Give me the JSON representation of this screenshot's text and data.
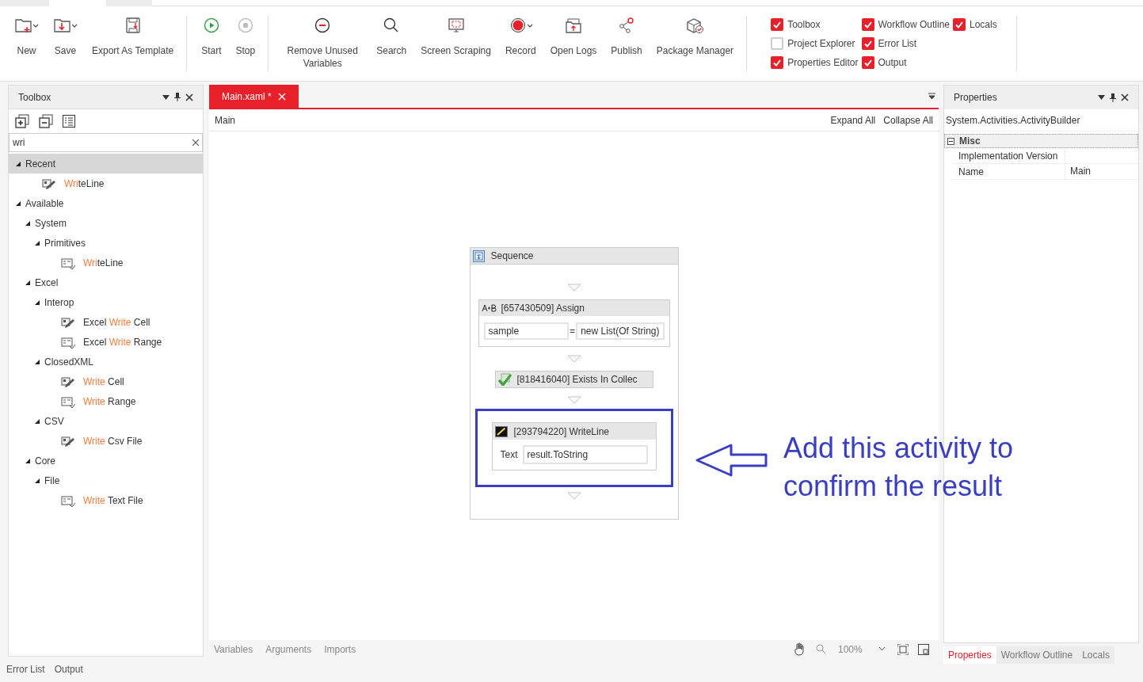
{
  "toolbar": {
    "groups": [
      {
        "buttons": [
          {
            "label": "New",
            "dropdown": true
          },
          {
            "label": "Save",
            "dropdown": true
          },
          {
            "label": "Export As Template",
            "dropdown": false
          }
        ]
      },
      {
        "buttons": [
          {
            "label": "Start",
            "dropdown": false
          },
          {
            "label": "Stop",
            "dropdown": false
          }
        ]
      },
      {
        "buttons": [
          {
            "label": "Remove Unused Variables",
            "dropdown": false
          },
          {
            "label": "Search",
            "dropdown": false
          },
          {
            "label": "Screen Scraping",
            "dropdown": false
          },
          {
            "label": "Record",
            "dropdown": true
          },
          {
            "label": "Open Logs",
            "dropdown": false
          },
          {
            "label": "Publish",
            "dropdown": false
          },
          {
            "label": "Package Manager",
            "dropdown": false
          }
        ]
      }
    ],
    "panel_toggles": [
      {
        "label": "Toolbox",
        "checked": true
      },
      {
        "label": "Workflow Outline",
        "checked": true
      },
      {
        "label": "Locals",
        "checked": true
      },
      {
        "label": "Project Explorer",
        "checked": false
      },
      {
        "label": "Error List",
        "checked": true
      },
      {
        "label": "Properties Editor",
        "checked": true
      },
      {
        "label": "Output",
        "checked": true
      }
    ]
  },
  "toolbox": {
    "title": "Toolbox",
    "search": {
      "value": "wri"
    },
    "tree": [
      {
        "label": "Recent",
        "expanded": true,
        "selected": true,
        "children": [
          {
            "match": "Wri",
            "after": "teLine",
            "selected": false
          }
        ]
      },
      {
        "label": "Available",
        "expanded": true,
        "selected": false,
        "children": [
          {
            "label": "System",
            "expanded": true,
            "selected": false,
            "children": [
              {
                "label": "Primitives",
                "expanded": true,
                "selected": false,
                "children": [
                  {
                    "match": "Wri",
                    "after": "teLine",
                    "selected": false
                  }
                ]
              }
            ]
          },
          {
            "label": "Excel",
            "expanded": true,
            "selected": false,
            "children": [
              {
                "label": "Interop",
                "expanded": true,
                "selected": false,
                "children": [
                  {
                    "before": "Excel ",
                    "match": "Write",
                    "after": " Cell",
                    "selected": false
                  },
                  {
                    "before": "Excel ",
                    "match": "Write",
                    "after": " Range",
                    "selected": false
                  }
                ]
              },
              {
                "label": "ClosedXML",
                "expanded": true,
                "selected": false,
                "children": [
                  {
                    "match": "Write",
                    "after": " Cell",
                    "selected": false
                  },
                  {
                    "match": "Write",
                    "after": " Range",
                    "selected": false
                  }
                ]
              },
              {
                "label": "CSV",
                "expanded": true,
                "selected": false,
                "children": [
                  {
                    "match": "Write",
                    "after": " Csv File",
                    "selected": false
                  }
                ]
              }
            ]
          },
          {
            "label": "Core",
            "expanded": true,
            "selected": false,
            "children": [
              {
                "label": "File",
                "expanded": true,
                "selected": false,
                "children": [
                  {
                    "match": "Write",
                    "after": " Text File",
                    "selected": false
                  }
                ]
              }
            ]
          }
        ]
      }
    ]
  },
  "document_tabs": [
    {
      "label": "Main.xaml *",
      "selected": true
    }
  ],
  "breadcrumb": "Main",
  "designer_actions": [
    "Expand All",
    "Collapse All"
  ],
  "sequence": {
    "title": "Sequence",
    "activities": [
      {
        "kind": "assign",
        "title": "[657430509] Assign",
        "to": "sample",
        "operator": "=",
        "value": "new List(Of String)",
        "highlighted": false
      },
      {
        "kind": "collapsed",
        "title": "[818416040] Exists In Collec",
        "highlighted": false
      },
      {
        "kind": "writeline",
        "title": "[293794220] WriteLine",
        "property": "Text",
        "value": "result.ToString",
        "highlighted": true
      }
    ]
  },
  "annotation": "Add this activity to confirm the result",
  "designer_bottom_tabs": [
    "Variables",
    "Arguments",
    "Imports"
  ],
  "zoom": "100%",
  "properties": {
    "title": "Properties",
    "subject": "System.Activities.ActivityBuilder",
    "category": {
      "label": "Misc",
      "expanded": true
    },
    "rows": [
      {
        "name": "Implementation Version"
      },
      {
        "name": "Name",
        "value": "Main"
      }
    ]
  },
  "right_tabs": [
    {
      "label": "Properties",
      "selected": true
    },
    {
      "label": "Workflow Outline",
      "selected": false
    },
    {
      "label": "Locals",
      "selected": false
    }
  ],
  "bottom_tabs": [
    {
      "label": "Error List",
      "selected": false
    },
    {
      "label": "Output",
      "selected": false
    }
  ]
}
